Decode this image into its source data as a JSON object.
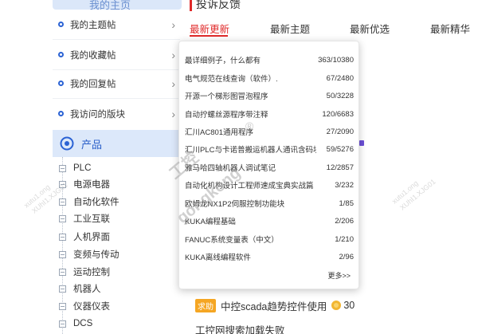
{
  "sidebar": {
    "top_cut_label": "我的主页",
    "menu": [
      {
        "label": "我的主题帖"
      },
      {
        "label": "我的收藏帖"
      },
      {
        "label": "我的回复帖"
      },
      {
        "label": "我访问的版块"
      }
    ],
    "product_header": "产品",
    "tree": [
      "PLC",
      "电源电器",
      "自动化软件",
      "工业互联",
      "人机界面",
      "变频与传动",
      "运动控制",
      "机器人",
      "仪器仪表",
      "DCS"
    ]
  },
  "main": {
    "section_title": "投诉反馈",
    "tabs": [
      "最新更新",
      "最新主题",
      "最新优选",
      "最新精华"
    ],
    "active_tab": 0,
    "panel": {
      "rows": [
        {
          "title": "最详细例子，什么都有",
          "count": "363/10380"
        },
        {
          "title": "电气规范在线查询（软件）.",
          "count": "67/2480"
        },
        {
          "title": "开源一个梯形图冒泡程序",
          "count": "50/3228"
        },
        {
          "title": "自动拧螺丝源程序带注释",
          "count": "120/6683"
        },
        {
          "title": "汇川AC801通用程序",
          "count": "27/2090"
        },
        {
          "title": "汇川PLC与卡诺普搬运机器人通讯含码块",
          "count": "59/5276"
        },
        {
          "title": "雅马哈四轴机器人调试笔记",
          "count": "12/2857"
        },
        {
          "title": "自动化机构设计工程师速成宝典实战篇",
          "count": "3/232"
        },
        {
          "title": "欧姆龙NX1P2伺服控制功能块",
          "count": "1/85"
        },
        {
          "title": "KUKA编程基础",
          "count": "2/206"
        },
        {
          "title": "FANUC系统变量表（中文）",
          "count": "1/210"
        },
        {
          "title": "KUKA离线编程软件",
          "count": "2/96"
        }
      ],
      "more_label": "更多>>"
    },
    "feed": {
      "badge": "求助",
      "title": "中控scada趋势控件使用",
      "points": "30",
      "next_title": "工控网搜索加载失败"
    }
  },
  "watermarks": {
    "brand": "gongkong",
    "brand_cn": "工控",
    "registered": "®",
    "user_id": "xutu1.ong",
    "user_code": "XUhI1.XJG01"
  },
  "colors": {
    "accent_red": "#e02a2a",
    "primary_blue": "#2a62d4",
    "product_bg": "#dce8fa",
    "badge_orange": "#f5a623"
  }
}
